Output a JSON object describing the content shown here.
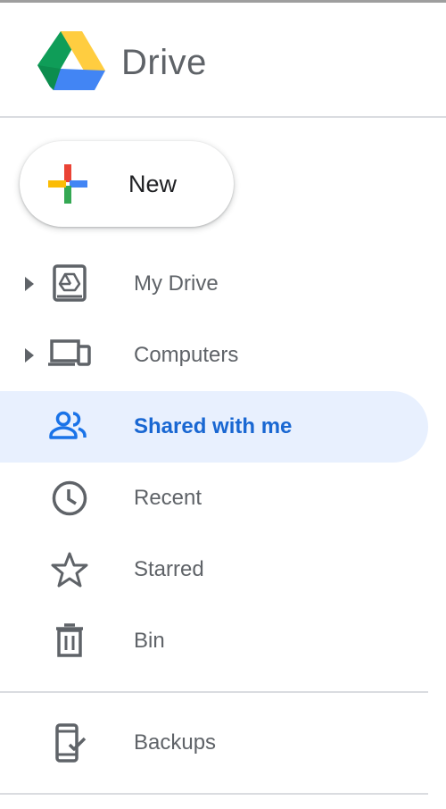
{
  "app": {
    "title": "Drive"
  },
  "new_button": {
    "label": "New"
  },
  "nav": {
    "items": [
      {
        "label": "My Drive",
        "icon": "my-drive-icon",
        "expandable": true,
        "active": false
      },
      {
        "label": "Computers",
        "icon": "computers-icon",
        "expandable": true,
        "active": false
      },
      {
        "label": "Shared with me",
        "icon": "shared-people-icon",
        "expandable": false,
        "active": true
      },
      {
        "label": "Recent",
        "icon": "clock-icon",
        "expandable": false,
        "active": false
      },
      {
        "label": "Starred",
        "icon": "star-icon",
        "expandable": false,
        "active": false
      },
      {
        "label": "Bin",
        "icon": "trash-icon",
        "expandable": false,
        "active": false
      }
    ],
    "secondary": [
      {
        "label": "Backups",
        "icon": "phone-check-icon",
        "active": false
      }
    ]
  },
  "colors": {
    "active_background": "#e8f0fe",
    "active_text": "#1967d2",
    "text": "#5f6368",
    "icon": "#5f6368",
    "divider": "#dadce0"
  }
}
